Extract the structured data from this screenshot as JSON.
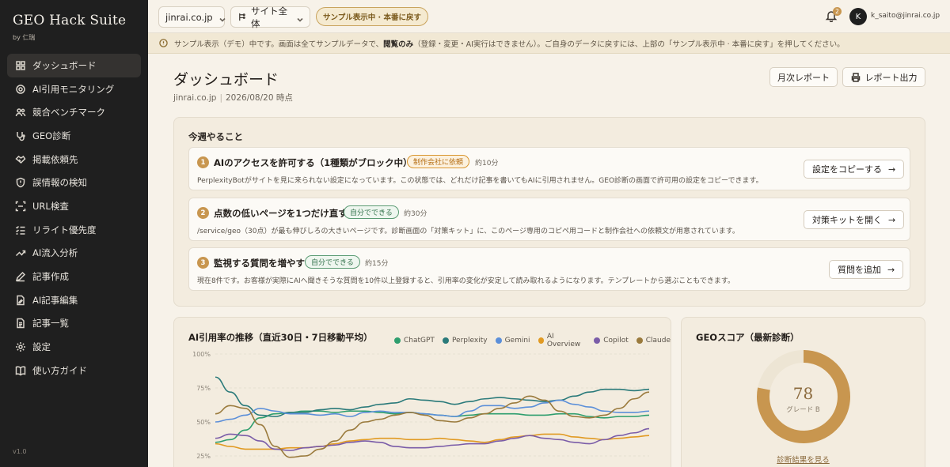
{
  "app": {
    "title": "GEO Hack Suite",
    "subtitle": "by 仁瑞",
    "version": "v1.0"
  },
  "sidebar": {
    "items": [
      {
        "label": "ダッシュボード",
        "icon": "grid-icon",
        "active": true
      },
      {
        "label": "AI引用モニタリング",
        "icon": "target-icon"
      },
      {
        "label": "競合ベンチマーク",
        "icon": "users-icon"
      },
      {
        "label": "GEO診断",
        "icon": "stethoscope-icon"
      },
      {
        "label": "掲載依頼先",
        "icon": "handshake-icon"
      },
      {
        "label": "誤情報の検知",
        "icon": "shield-alert-icon"
      },
      {
        "label": "URL検査",
        "icon": "scan-icon"
      },
      {
        "label": "リライト優先度",
        "icon": "list-check-icon"
      },
      {
        "label": "AI流入分析",
        "icon": "trend-icon"
      },
      {
        "label": "記事作成",
        "icon": "pen-icon"
      },
      {
        "label": "AI記事編集",
        "icon": "file-edit-icon"
      },
      {
        "label": "記事一覧",
        "icon": "file-list-icon"
      },
      {
        "label": "設定",
        "icon": "gear-icon"
      },
      {
        "label": "使い方ガイド",
        "icon": "book-icon"
      }
    ]
  },
  "topbar": {
    "domain_select": "jinrai.co.jp",
    "scope_select": "サイト全体",
    "sample_pill": "サンプル表示中 · 本番に戻す",
    "notification_count": "2",
    "avatar_initial": "K",
    "user_email": "k_saito@jinrai.co.jp"
  },
  "notice": {
    "text_before": "サンプル表示（デモ）中です。画面は全てサンプルデータで、",
    "text_bold": "閲覧のみ",
    "text_after": "（登録・変更・AI実行はできません）。ご自身のデータに戻すには、上部の「サンプル表示中 · 本番に戻す」を押してください。"
  },
  "page": {
    "title": "ダッシュボード",
    "domain": "jinrai.co.jp",
    "date": "2026/08/20 時点",
    "monthly_report_label": "月次レポート",
    "export_report_label": "レポート出力"
  },
  "tasks": {
    "title": "今週やること",
    "items": [
      {
        "num": "1",
        "title": "AIのアクセスを許可する（1種類がブロック中）",
        "badge": "制作会社に依頼",
        "badge_type": "orange",
        "time": "約10分",
        "desc": "PerplexityBotがサイトを見に来られない設定になっています。この状態では、どれだけ記事を書いてもAIに引用されません。GEO診断の画面で許可用の設定をコピーできます。",
        "button": "設定をコピーする"
      },
      {
        "num": "2",
        "title": "点数の低いページを1つだけ直す",
        "badge": "自分でできる",
        "badge_type": "green",
        "time": "約30分",
        "desc": "/service/geo（30点）が最も伸びしろの大きいページです。診断画面の「対策キット」に、このページ専用のコピペ用コードと制作会社への依頼文が用意されています。",
        "button": "対策キットを開く"
      },
      {
        "num": "3",
        "title": "監視する質問を増やす",
        "badge": "自分でできる",
        "badge_type": "green",
        "time": "約15分",
        "desc": "現在8件です。お客様が実際にAIへ聞きそうな質問を10件以上登録すると、引用率の変化が安定して読み取れるようになります。テンプレートから選ぶこともできます。",
        "button": "質問を追加"
      }
    ]
  },
  "chart": {
    "title": "AI引用率の推移（直近30日・7日移動平均）",
    "y_ticks": [
      "100%",
      "75%",
      "50%",
      "25%"
    ]
  },
  "chart_data": {
    "type": "line",
    "ylim": [
      0,
      100
    ],
    "y_unit": "%",
    "x_days": 30,
    "series": [
      {
        "name": "ChatGPT",
        "color": "#2e9e6e",
        "values": [
          35,
          37,
          44,
          53,
          56,
          57,
          58,
          58,
          57,
          58,
          58,
          57,
          56,
          57,
          56,
          55,
          54,
          55,
          56,
          56,
          56,
          55,
          55,
          56,
          56,
          54,
          53,
          54,
          54,
          55
        ]
      },
      {
        "name": "Perplexity",
        "color": "#2a7a7a",
        "values": [
          83,
          72,
          62,
          55,
          54,
          57,
          57,
          59,
          60,
          59,
          61,
          63,
          64,
          67,
          66,
          65,
          63,
          65,
          67,
          68,
          67,
          66,
          65,
          66,
          69,
          72,
          74,
          74,
          73,
          74
        ]
      },
      {
        "name": "Gemini",
        "color": "#5b8fd9",
        "values": [
          50,
          52,
          55,
          60,
          58,
          56,
          56,
          55,
          56,
          54,
          57,
          58,
          57,
          57,
          56,
          55,
          54,
          58,
          62,
          62,
          60,
          61,
          64,
          66,
          63,
          61,
          58,
          57,
          57,
          58
        ]
      },
      {
        "name": "AI Overview",
        "color": "#e19a22",
        "values": [
          34,
          32,
          30,
          30,
          30,
          31,
          31,
          32,
          34,
          36,
          37,
          38,
          38,
          37,
          37,
          38,
          37,
          36,
          35,
          37,
          39,
          40,
          41,
          41,
          39,
          38,
          37,
          38,
          39,
          40
        ]
      },
      {
        "name": "Copilot",
        "color": "#7a5ca8",
        "values": [
          38,
          41,
          40,
          36,
          30,
          29,
          31,
          32,
          33,
          35,
          36,
          35,
          32,
          31,
          31,
          32,
          33,
          34,
          34,
          36,
          38,
          40,
          38,
          37,
          35,
          34,
          37,
          40,
          42,
          45
        ]
      },
      {
        "name": "Claude",
        "color": "#9a7a3c",
        "values": [
          56,
          62,
          60,
          48,
          32,
          24,
          25,
          30,
          36,
          44,
          50,
          52,
          55,
          57,
          55,
          51,
          50,
          53,
          56,
          60,
          64,
          69,
          66,
          58,
          54,
          53,
          55,
          60,
          67,
          72
        ]
      }
    ]
  },
  "score": {
    "title": "GEOスコア（最新診断）",
    "value": "78",
    "value_num": 78,
    "grade": "グレード B",
    "link": "診断結果を見る"
  }
}
